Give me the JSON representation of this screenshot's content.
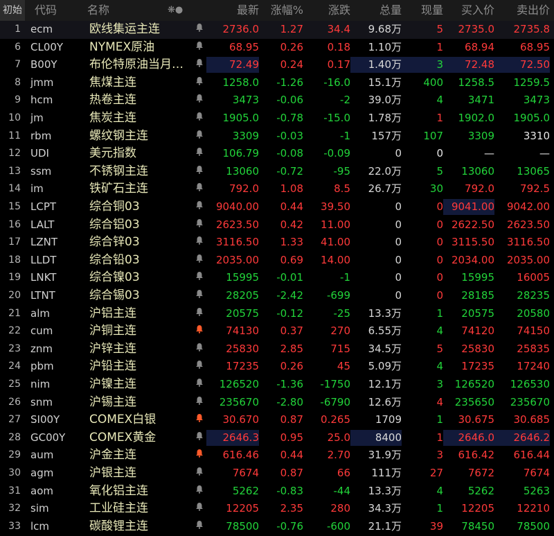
{
  "header": {
    "mode": "初始",
    "code": "代码",
    "name": "名称",
    "flag": "❋●",
    "last": "最新",
    "chg_pct": "涨幅%",
    "change": "涨跌",
    "volume": "总量",
    "cur_vol": "现量",
    "bid": "买入价",
    "ask": "卖出价"
  },
  "rows": [
    {
      "idx": "1",
      "code": "ecm",
      "name": "欧线集运主连",
      "bell": "bell-icon",
      "last": "2736.0",
      "chg": "1.27",
      "diff": "34.4",
      "vol": "9.68万",
      "cur": "5",
      "bid": "2735.0",
      "ask": "2735.8",
      "dir": "up",
      "curdir": "up",
      "biddir": "up",
      "askdir": "up"
    },
    {
      "idx": "6",
      "code": "CL00Y",
      "name": "NYMEX原油",
      "bell": "bell-icon",
      "last": "68.95",
      "chg": "0.26",
      "diff": "0.18",
      "vol": "1.10万",
      "cur": "1",
      "bid": "68.94",
      "ask": "68.95",
      "dir": "up",
      "curdir": "up",
      "biddir": "up",
      "askdir": "up"
    },
    {
      "idx": "7",
      "code": "B00Y",
      "name": "布伦特原油当月…",
      "bell": "bell-icon",
      "last": "72.49",
      "chg": "0.24",
      "diff": "0.17",
      "vol": "1.40万",
      "cur": "3",
      "bid": "72.48",
      "ask": "72.50",
      "dir": "up",
      "curdir": "green",
      "biddir": "up",
      "askdir": "up"
    },
    {
      "idx": "8",
      "code": "jmm",
      "name": "焦煤主连",
      "bell": "bell-icon",
      "last": "1258.0",
      "chg": "-1.26",
      "diff": "-16.0",
      "vol": "15.1万",
      "cur": "400",
      "bid": "1258.5",
      "ask": "1259.5",
      "dir": "down",
      "curdir": "green",
      "biddir": "down",
      "askdir": "down"
    },
    {
      "idx": "9",
      "code": "hcm",
      "name": "热卷主连",
      "bell": "bell-icon",
      "last": "3473",
      "chg": "-0.06",
      "diff": "-2",
      "vol": "39.0万",
      "cur": "4",
      "bid": "3471",
      "ask": "3473",
      "dir": "down",
      "curdir": "green",
      "biddir": "down",
      "askdir": "down"
    },
    {
      "idx": "10",
      "code": "jm",
      "name": "焦炭主连",
      "bell": "bell-icon",
      "last": "1905.0",
      "chg": "-0.78",
      "diff": "-15.0",
      "vol": "1.78万",
      "cur": "1",
      "bid": "1902.0",
      "ask": "1905.0",
      "dir": "down",
      "curdir": "up",
      "biddir": "down",
      "askdir": "down"
    },
    {
      "idx": "11",
      "code": "rbm",
      "name": "螺纹钢主连",
      "bell": "bell-icon",
      "last": "3309",
      "chg": "-0.03",
      "diff": "-1",
      "vol": "157万",
      "cur": "107",
      "bid": "3309",
      "ask": "3310",
      "dir": "down",
      "curdir": "green",
      "biddir": "down",
      "askdir": "flat"
    },
    {
      "idx": "12",
      "code": "UDI",
      "name": "美元指数",
      "bell": "bell-icon",
      "last": "106.79",
      "chg": "-0.08",
      "diff": "-0.09",
      "vol": "0",
      "cur": "0",
      "bid": "—",
      "ask": "—",
      "dir": "down",
      "curdir": "flat",
      "biddir": "flat",
      "askdir": "flat"
    },
    {
      "idx": "13",
      "code": "ssm",
      "name": "不锈钢主连",
      "bell": "bell-icon",
      "last": "13060",
      "chg": "-0.72",
      "diff": "-95",
      "vol": "22.0万",
      "cur": "5",
      "bid": "13060",
      "ask": "13065",
      "dir": "down",
      "curdir": "green",
      "biddir": "down",
      "askdir": "down"
    },
    {
      "idx": "14",
      "code": "im",
      "name": "铁矿石主连",
      "bell": "bell-icon",
      "last": "792.0",
      "chg": "1.08",
      "diff": "8.5",
      "vol": "26.7万",
      "cur": "30",
      "bid": "792.0",
      "ask": "792.5",
      "dir": "up",
      "curdir": "green",
      "biddir": "up",
      "askdir": "up"
    },
    {
      "idx": "15",
      "code": "LCPT",
      "name": "综合铜03",
      "bell": "bell-icon",
      "last": "9040.00",
      "chg": "0.44",
      "diff": "39.50",
      "vol": "0",
      "cur": "0",
      "bid": "9041.00",
      "ask": "9042.00",
      "dir": "up",
      "curdir": "up",
      "biddir": "up",
      "askdir": "up"
    },
    {
      "idx": "16",
      "code": "LALT",
      "name": "综合铝03",
      "bell": "bell-icon",
      "last": "2623.50",
      "chg": "0.42",
      "diff": "11.00",
      "vol": "0",
      "cur": "0",
      "bid": "2622.50",
      "ask": "2623.50",
      "dir": "up",
      "curdir": "up",
      "biddir": "up",
      "askdir": "up"
    },
    {
      "idx": "17",
      "code": "LZNT",
      "name": "综合锌03",
      "bell": "bell-icon",
      "last": "3116.50",
      "chg": "1.33",
      "diff": "41.00",
      "vol": "0",
      "cur": "0",
      "bid": "3115.50",
      "ask": "3116.50",
      "dir": "up",
      "curdir": "up",
      "biddir": "up",
      "askdir": "up"
    },
    {
      "idx": "18",
      "code": "LLDT",
      "name": "综合铅03",
      "bell": "bell-icon",
      "last": "2035.00",
      "chg": "0.69",
      "diff": "14.00",
      "vol": "0",
      "cur": "0",
      "bid": "2034.00",
      "ask": "2035.00",
      "dir": "up",
      "curdir": "up",
      "biddir": "up",
      "askdir": "up"
    },
    {
      "idx": "19",
      "code": "LNKT",
      "name": "综合镍03",
      "bell": "bell-icon",
      "last": "15995",
      "chg": "-0.01",
      "diff": "-1",
      "vol": "0",
      "cur": "0",
      "bid": "15995",
      "ask": "16005",
      "dir": "down",
      "curdir": "up",
      "biddir": "down",
      "askdir": "up"
    },
    {
      "idx": "20",
      "code": "LTNT",
      "name": "综合锡03",
      "bell": "bell-icon",
      "last": "28205",
      "chg": "-2.42",
      "diff": "-699",
      "vol": "0",
      "cur": "0",
      "bid": "28185",
      "ask": "28235",
      "dir": "down",
      "curdir": "up",
      "biddir": "down",
      "askdir": "down"
    },
    {
      "idx": "21",
      "code": "alm",
      "name": "沪铝主连",
      "bell": "bell-icon",
      "last": "20575",
      "chg": "-0.12",
      "diff": "-25",
      "vol": "13.3万",
      "cur": "1",
      "bid": "20575",
      "ask": "20580",
      "dir": "down",
      "curdir": "green",
      "biddir": "down",
      "askdir": "down"
    },
    {
      "idx": "22",
      "code": "cum",
      "name": "沪铜主连",
      "bell": "bell-active-icon",
      "last": "74130",
      "chg": "0.37",
      "diff": "270",
      "vol": "6.55万",
      "cur": "4",
      "bid": "74120",
      "ask": "74150",
      "dir": "up",
      "curdir": "green",
      "biddir": "up",
      "askdir": "up"
    },
    {
      "idx": "23",
      "code": "znm",
      "name": "沪锌主连",
      "bell": "bell-icon",
      "last": "25830",
      "chg": "2.85",
      "diff": "715",
      "vol": "34.5万",
      "cur": "5",
      "bid": "25830",
      "ask": "25835",
      "dir": "up",
      "curdir": "up",
      "biddir": "up",
      "askdir": "up"
    },
    {
      "idx": "24",
      "code": "pbm",
      "name": "沪铅主连",
      "bell": "bell-icon",
      "last": "17235",
      "chg": "0.26",
      "diff": "45",
      "vol": "5.09万",
      "cur": "4",
      "bid": "17235",
      "ask": "17240",
      "dir": "up",
      "curdir": "green",
      "biddir": "up",
      "askdir": "up"
    },
    {
      "idx": "25",
      "code": "nim",
      "name": "沪镍主连",
      "bell": "bell-icon",
      "last": "126520",
      "chg": "-1.36",
      "diff": "-1750",
      "vol": "12.1万",
      "cur": "3",
      "bid": "126520",
      "ask": "126530",
      "dir": "down",
      "curdir": "green",
      "biddir": "down",
      "askdir": "down"
    },
    {
      "idx": "26",
      "code": "snm",
      "name": "沪锡主连",
      "bell": "bell-icon",
      "last": "235670",
      "chg": "-2.80",
      "diff": "-6790",
      "vol": "12.6万",
      "cur": "4",
      "bid": "235650",
      "ask": "235670",
      "dir": "down",
      "curdir": "up",
      "biddir": "down",
      "askdir": "down"
    },
    {
      "idx": "27",
      "code": "SI00Y",
      "name": "COMEX白银",
      "bell": "bell-active-icon",
      "last": "30.670",
      "chg": "0.87",
      "diff": "0.265",
      "vol": "1709",
      "cur": "1",
      "bid": "30.675",
      "ask": "30.685",
      "dir": "up",
      "curdir": "green",
      "biddir": "up",
      "askdir": "up"
    },
    {
      "idx": "28",
      "code": "GC00Y",
      "name": "COMEX黄金",
      "bell": "bell-icon",
      "last": "2646.3",
      "chg": "0.95",
      "diff": "25.0",
      "vol": "8400",
      "cur": "1",
      "bid": "2646.0",
      "ask": "2646.2",
      "dir": "up",
      "curdir": "up",
      "biddir": "up",
      "askdir": "up"
    },
    {
      "idx": "29",
      "code": "aum",
      "name": "沪金主连",
      "bell": "bell-active-icon",
      "last": "616.46",
      "chg": "0.44",
      "diff": "2.70",
      "vol": "31.9万",
      "cur": "3",
      "bid": "616.42",
      "ask": "616.44",
      "dir": "up",
      "curdir": "up",
      "biddir": "up",
      "askdir": "up"
    },
    {
      "idx": "30",
      "code": "agm",
      "name": "沪银主连",
      "bell": "bell-icon",
      "last": "7674",
      "chg": "0.87",
      "diff": "66",
      "vol": "111万",
      "cur": "27",
      "bid": "7672",
      "ask": "7674",
      "dir": "up",
      "curdir": "up",
      "biddir": "up",
      "askdir": "up"
    },
    {
      "idx": "31",
      "code": "aom",
      "name": "氧化铝主连",
      "bell": "bell-icon",
      "last": "5262",
      "chg": "-0.83",
      "diff": "-44",
      "vol": "13.3万",
      "cur": "4",
      "bid": "5262",
      "ask": "5263",
      "dir": "down",
      "curdir": "green",
      "biddir": "down",
      "askdir": "down"
    },
    {
      "idx": "32",
      "code": "sim",
      "name": "工业硅主连",
      "bell": "bell-icon",
      "last": "12205",
      "chg": "2.35",
      "diff": "280",
      "vol": "34.3万",
      "cur": "1",
      "bid": "12205",
      "ask": "12210",
      "dir": "up",
      "curdir": "green",
      "biddir": "up",
      "askdir": "up"
    },
    {
      "idx": "33",
      "code": "lcm",
      "name": "碳酸锂主连",
      "bell": "bell-icon",
      "last": "78500",
      "chg": "-0.76",
      "diff": "-600",
      "vol": "21.1万",
      "cur": "39",
      "bid": "78450",
      "ask": "78500",
      "dir": "down",
      "curdir": "up",
      "biddir": "down",
      "askdir": "down"
    }
  ]
}
